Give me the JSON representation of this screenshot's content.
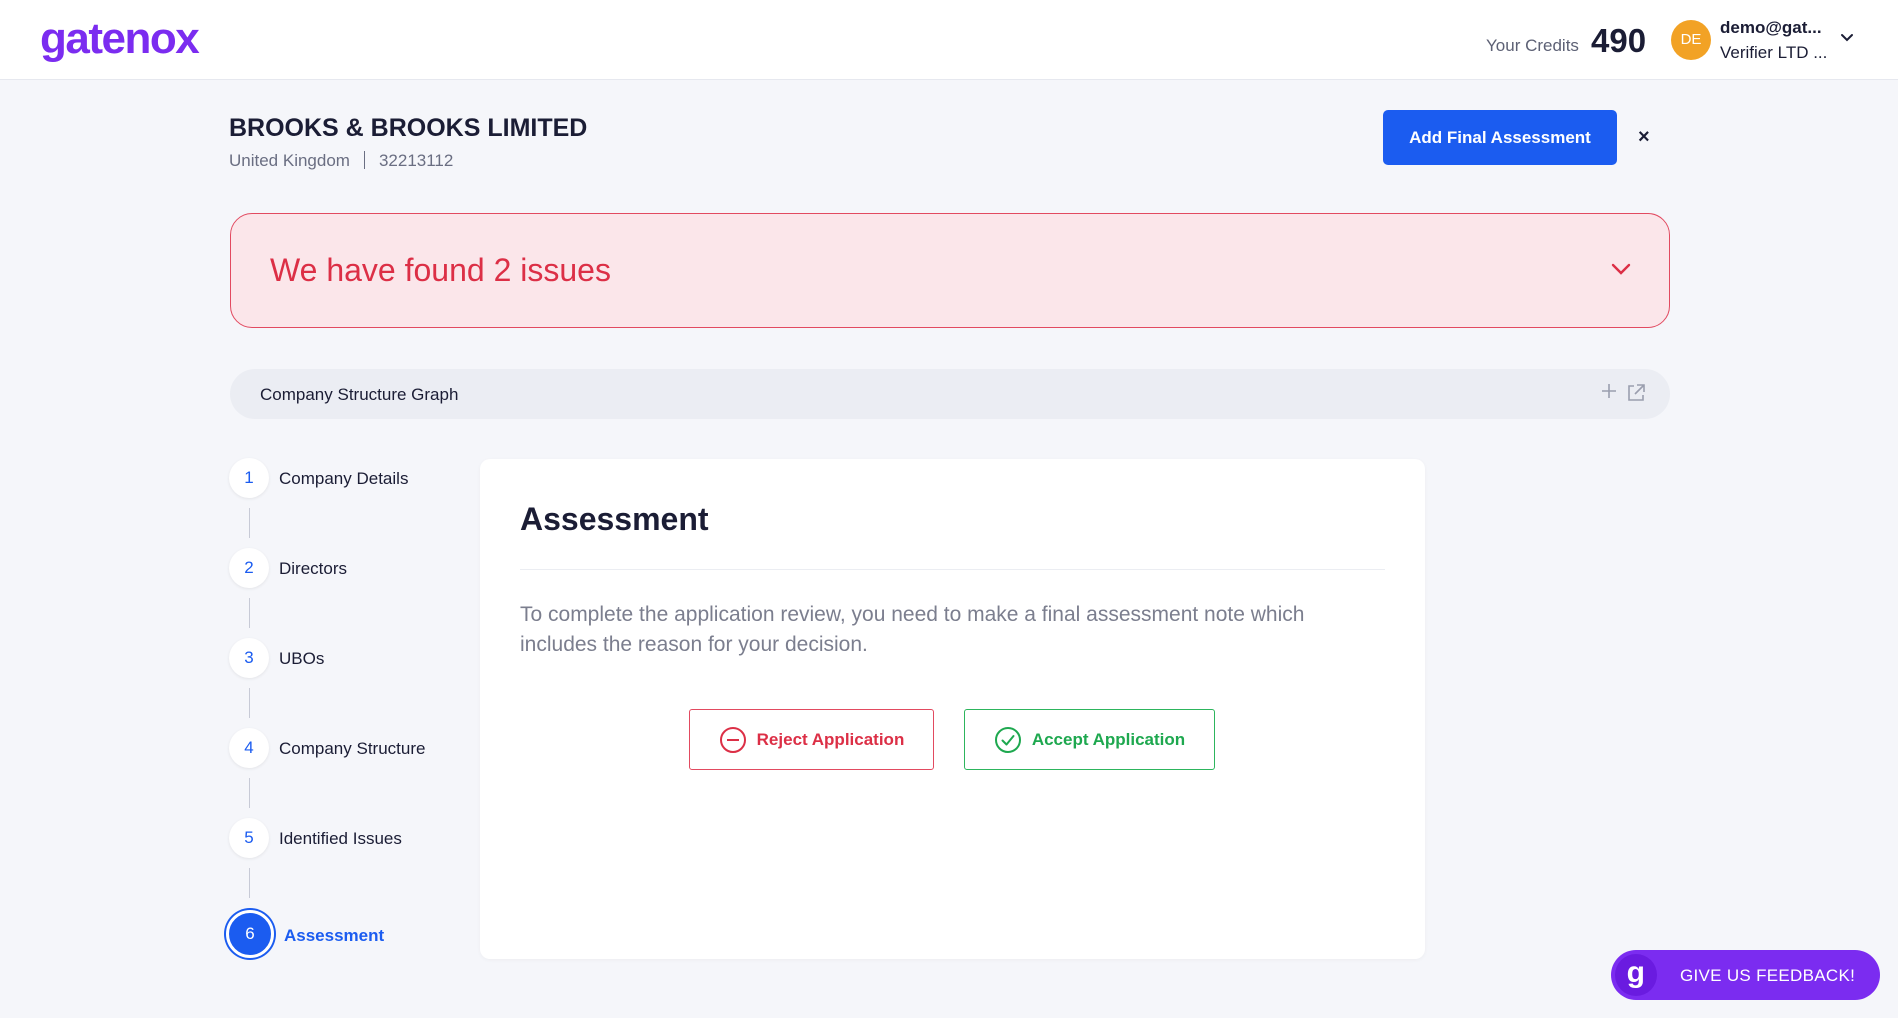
{
  "header": {
    "logo": "gatenox",
    "credits_label": "Your Credits",
    "credits_value": "490",
    "avatar_initials": "DE",
    "user_email": "demo@gat...",
    "user_org": "Verifier LTD ..."
  },
  "company": {
    "name": "BROOKS & BROOKS LIMITED",
    "country": "United Kingdom",
    "number": "32213112"
  },
  "actions": {
    "add_final_assessment": "Add Final Assessment",
    "close": "×"
  },
  "issues": {
    "title": "We have found 2 issues"
  },
  "graph": {
    "title": "Company Structure Graph",
    "plus": "+"
  },
  "steps": [
    {
      "number": "1",
      "label": "Company Details"
    },
    {
      "number": "2",
      "label": "Directors"
    },
    {
      "number": "3",
      "label": "UBOs"
    },
    {
      "number": "4",
      "label": "Company Structure"
    },
    {
      "number": "5",
      "label": "Identified Issues"
    },
    {
      "number": "6",
      "label": "Assessment",
      "active": true
    }
  ],
  "assessment": {
    "title": "Assessment",
    "description": "To complete the application review, you need to make a final assessment note which includes the reason for your decision.",
    "reject_label": "Reject Application",
    "accept_label": "Accept Application"
  },
  "feedback": {
    "icon_letter": "g",
    "label": "GIVE US FEEDBACK!"
  },
  "colors": {
    "brand": "#7b2cf0",
    "primary": "#1b5cf0",
    "danger": "#dc2f46",
    "success": "#1ea84f",
    "avatar": "#f2a225"
  }
}
